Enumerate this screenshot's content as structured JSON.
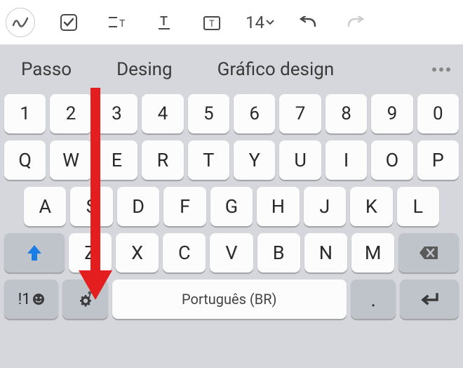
{
  "toolbar": {
    "fontsize": "14"
  },
  "suggestions": {
    "items": [
      "Passo",
      "Desing",
      "Gráfico design"
    ]
  },
  "keyboard": {
    "row_numbers": [
      "1",
      "2",
      "3",
      "4",
      "5",
      "6",
      "7",
      "8",
      "9",
      "0"
    ],
    "row_qwerty": [
      "Q",
      "W",
      "E",
      "R",
      "T",
      "Y",
      "U",
      "I",
      "O",
      "P"
    ],
    "row_asdf": [
      "A",
      "S",
      "D",
      "F",
      "G",
      "H",
      "J",
      "K",
      "L"
    ],
    "row_zxcv": [
      "Z",
      "X",
      "C",
      "V",
      "B",
      "N",
      "M"
    ],
    "symbols_key": "!1",
    "space_label": "Português (BR)",
    "period_key": "."
  },
  "colors": {
    "arrow": "#e41e1e",
    "shift": "#1a7de6"
  }
}
